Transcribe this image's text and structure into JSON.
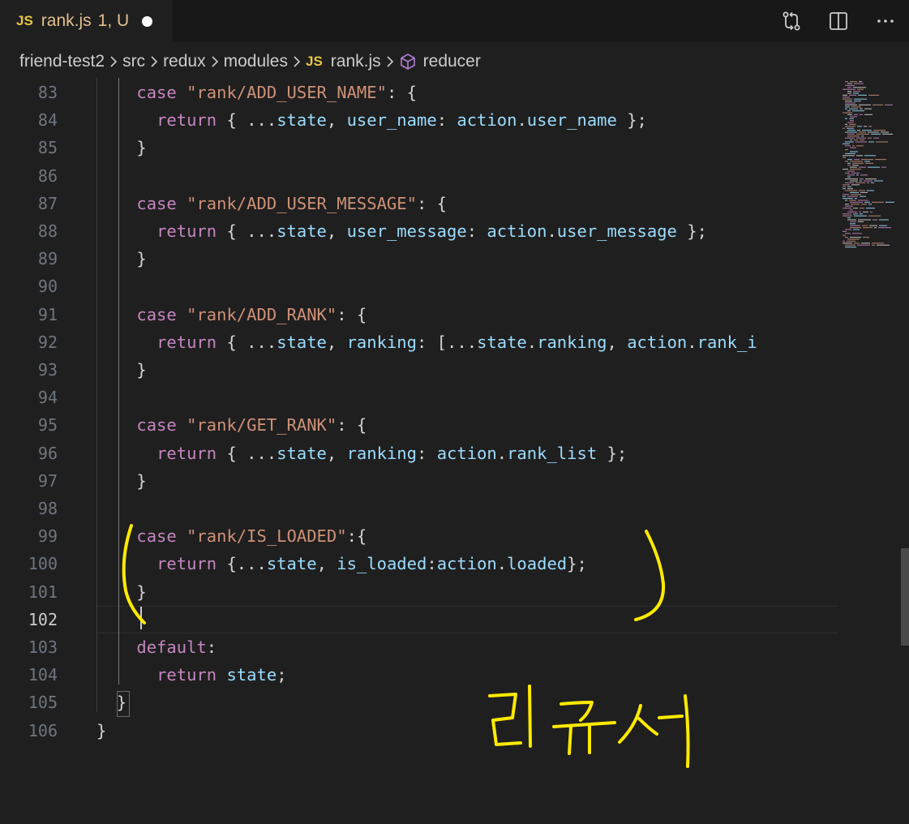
{
  "tab": {
    "js_badge": "JS",
    "filename": "rank.js",
    "status": "1, U"
  },
  "actions": [
    {
      "name": "compare-changes-icon"
    },
    {
      "name": "split-editor-icon"
    },
    {
      "name": "more-actions-icon"
    }
  ],
  "breadcrumb": {
    "items": [
      "friend-test2",
      "src",
      "redux",
      "modules"
    ],
    "file_badge": "JS",
    "file": "rank.js",
    "symbol_icon": "symbol-method-icon",
    "symbol": "reducer"
  },
  "editor": {
    "current_line": 102,
    "lines": [
      {
        "n": "83",
        "tokens": [
          [
            "i",
            "    "
          ],
          [
            "kw",
            "case"
          ],
          [
            "p",
            " "
          ],
          [
            "str",
            "\"rank/ADD_USER_NAME\""
          ],
          [
            "p",
            ": {"
          ]
        ]
      },
      {
        "n": "84",
        "tokens": [
          [
            "i",
            "      "
          ],
          [
            "kw",
            "return"
          ],
          [
            "p",
            " { ..."
          ],
          [
            "prop",
            "state"
          ],
          [
            "p",
            ", "
          ],
          [
            "prop",
            "user_name"
          ],
          [
            "p",
            ": "
          ],
          [
            "prop",
            "action"
          ],
          [
            "p",
            "."
          ],
          [
            "prop",
            "user_name"
          ],
          [
            "p",
            " };"
          ]
        ]
      },
      {
        "n": "85",
        "tokens": [
          [
            "i",
            "    "
          ],
          [
            "p",
            "}"
          ]
        ]
      },
      {
        "n": "86",
        "tokens": []
      },
      {
        "n": "87",
        "tokens": [
          [
            "i",
            "    "
          ],
          [
            "kw",
            "case"
          ],
          [
            "p",
            " "
          ],
          [
            "str",
            "\"rank/ADD_USER_MESSAGE\""
          ],
          [
            "p",
            ": {"
          ]
        ]
      },
      {
        "n": "88",
        "tokens": [
          [
            "i",
            "      "
          ],
          [
            "kw",
            "return"
          ],
          [
            "p",
            " { ..."
          ],
          [
            "prop",
            "state"
          ],
          [
            "p",
            ", "
          ],
          [
            "prop",
            "user_message"
          ],
          [
            "p",
            ": "
          ],
          [
            "prop",
            "action"
          ],
          [
            "p",
            "."
          ],
          [
            "prop",
            "user_message"
          ],
          [
            "p",
            " };"
          ]
        ]
      },
      {
        "n": "89",
        "tokens": [
          [
            "i",
            "    "
          ],
          [
            "p",
            "}"
          ]
        ]
      },
      {
        "n": "90",
        "tokens": []
      },
      {
        "n": "91",
        "tokens": [
          [
            "i",
            "    "
          ],
          [
            "kw",
            "case"
          ],
          [
            "p",
            " "
          ],
          [
            "str",
            "\"rank/ADD_RANK\""
          ],
          [
            "p",
            ": {"
          ]
        ]
      },
      {
        "n": "92",
        "tokens": [
          [
            "i",
            "      "
          ],
          [
            "kw",
            "return"
          ],
          [
            "p",
            " { ..."
          ],
          [
            "prop",
            "state"
          ],
          [
            "p",
            ", "
          ],
          [
            "prop",
            "ranking"
          ],
          [
            "p",
            ": [..."
          ],
          [
            "prop",
            "state"
          ],
          [
            "p",
            "."
          ],
          [
            "prop",
            "ranking"
          ],
          [
            "p",
            ", "
          ],
          [
            "prop",
            "action"
          ],
          [
            "p",
            "."
          ],
          [
            "prop",
            "rank_i"
          ]
        ]
      },
      {
        "n": "93",
        "tokens": [
          [
            "i",
            "    "
          ],
          [
            "p",
            "}"
          ]
        ]
      },
      {
        "n": "94",
        "tokens": []
      },
      {
        "n": "95",
        "tokens": [
          [
            "i",
            "    "
          ],
          [
            "kw",
            "case"
          ],
          [
            "p",
            " "
          ],
          [
            "str",
            "\"rank/GET_RANK\""
          ],
          [
            "p",
            ": {"
          ]
        ]
      },
      {
        "n": "96",
        "tokens": [
          [
            "i",
            "      "
          ],
          [
            "kw",
            "return"
          ],
          [
            "p",
            " { ..."
          ],
          [
            "prop",
            "state"
          ],
          [
            "p",
            ", "
          ],
          [
            "prop",
            "ranking"
          ],
          [
            "p",
            ": "
          ],
          [
            "prop",
            "action"
          ],
          [
            "p",
            "."
          ],
          [
            "prop",
            "rank_list"
          ],
          [
            "p",
            " };"
          ]
        ]
      },
      {
        "n": "97",
        "tokens": [
          [
            "i",
            "    "
          ],
          [
            "p",
            "}"
          ]
        ]
      },
      {
        "n": "98",
        "tokens": []
      },
      {
        "n": "99",
        "tokens": [
          [
            "i",
            "    "
          ],
          [
            "kw",
            "case"
          ],
          [
            "p",
            " "
          ],
          [
            "str",
            "\"rank/IS_LOADED\""
          ],
          [
            "p",
            ":{"
          ]
        ]
      },
      {
        "n": "100",
        "tokens": [
          [
            "i",
            "      "
          ],
          [
            "kw",
            "return"
          ],
          [
            "p",
            " {..."
          ],
          [
            "prop",
            "state"
          ],
          [
            "p",
            ", "
          ],
          [
            "prop",
            "is_loaded"
          ],
          [
            "p",
            ":"
          ],
          [
            "prop",
            "action"
          ],
          [
            "p",
            "."
          ],
          [
            "prop",
            "loaded"
          ],
          [
            "p",
            "};"
          ]
        ]
      },
      {
        "n": "101",
        "tokens": [
          [
            "i",
            "    "
          ],
          [
            "p",
            "}"
          ]
        ]
      },
      {
        "n": "102",
        "tokens": []
      },
      {
        "n": "103",
        "tokens": [
          [
            "i",
            "    "
          ],
          [
            "kw",
            "default"
          ],
          [
            "p",
            ":"
          ]
        ]
      },
      {
        "n": "104",
        "tokens": [
          [
            "i",
            "      "
          ],
          [
            "kw",
            "return"
          ],
          [
            "p",
            " "
          ],
          [
            "prop",
            "state"
          ],
          [
            "p",
            ";"
          ]
        ]
      },
      {
        "n": "105",
        "tokens": [
          [
            "i",
            "  "
          ],
          [
            "p",
            "}"
          ]
        ]
      },
      {
        "n": "106",
        "tokens": [
          [
            "p",
            "}"
          ]
        ]
      }
    ]
  },
  "annotation": {
    "handwritten_text": "리듀서",
    "ink_color": "#ffea00"
  },
  "colors": {
    "keyword": "#c586c0",
    "string": "#ce9178",
    "property": "#9cdcfe",
    "punctuation": "#d4d4d4",
    "js_badge": "#e8c547",
    "tab_label": "#e2c08d"
  }
}
